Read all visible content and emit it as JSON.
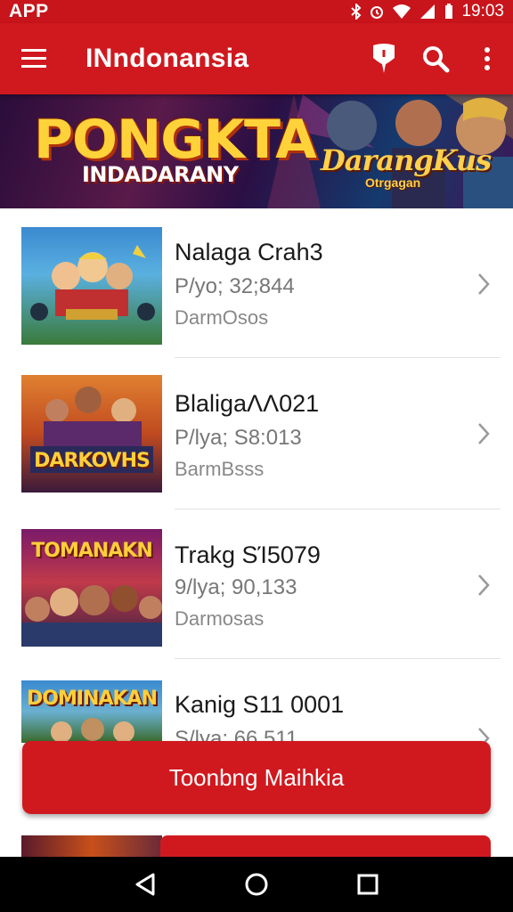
{
  "status_bar": {
    "app": "APP",
    "time": "19:03"
  },
  "app_bar": {
    "title": "INndonansia",
    "icons": [
      "menu-icon",
      "location-pin-icon",
      "search-icon",
      "more-vert-icon"
    ]
  },
  "banner": {
    "title": "PONGKTA",
    "subtitle": "INDADARANY",
    "logo": "DarangKus",
    "logo_sub": "Otrgagan"
  },
  "list": {
    "items": [
      {
        "title": "Nalaga Crah3",
        "line1": "P/yo; 32;844",
        "line2": "DarmOsos",
        "thumb_text": ""
      },
      {
        "title": "BlaligaΛΛ021",
        "line1": "P/lya; S8:013",
        "line2": "BarmBsss",
        "thumb_text": "DARKOVHS"
      },
      {
        "title": "Trakg ЅΊ5079",
        "line1": "9/lya; 90,133",
        "line2": "Darmosas",
        "thumb_text": "TOMANAKN"
      },
      {
        "title": "Kanig Ѕ11 0001",
        "line1": "S/lya; 66,511",
        "line2": "",
        "thumb_text": "DOMINAKAN"
      }
    ]
  },
  "primary_button": {
    "label": "Toonbng Maihkia"
  },
  "colors": {
    "brand_red": "#d0191f",
    "status_red": "#c8141b",
    "nav_black": "#000000"
  }
}
